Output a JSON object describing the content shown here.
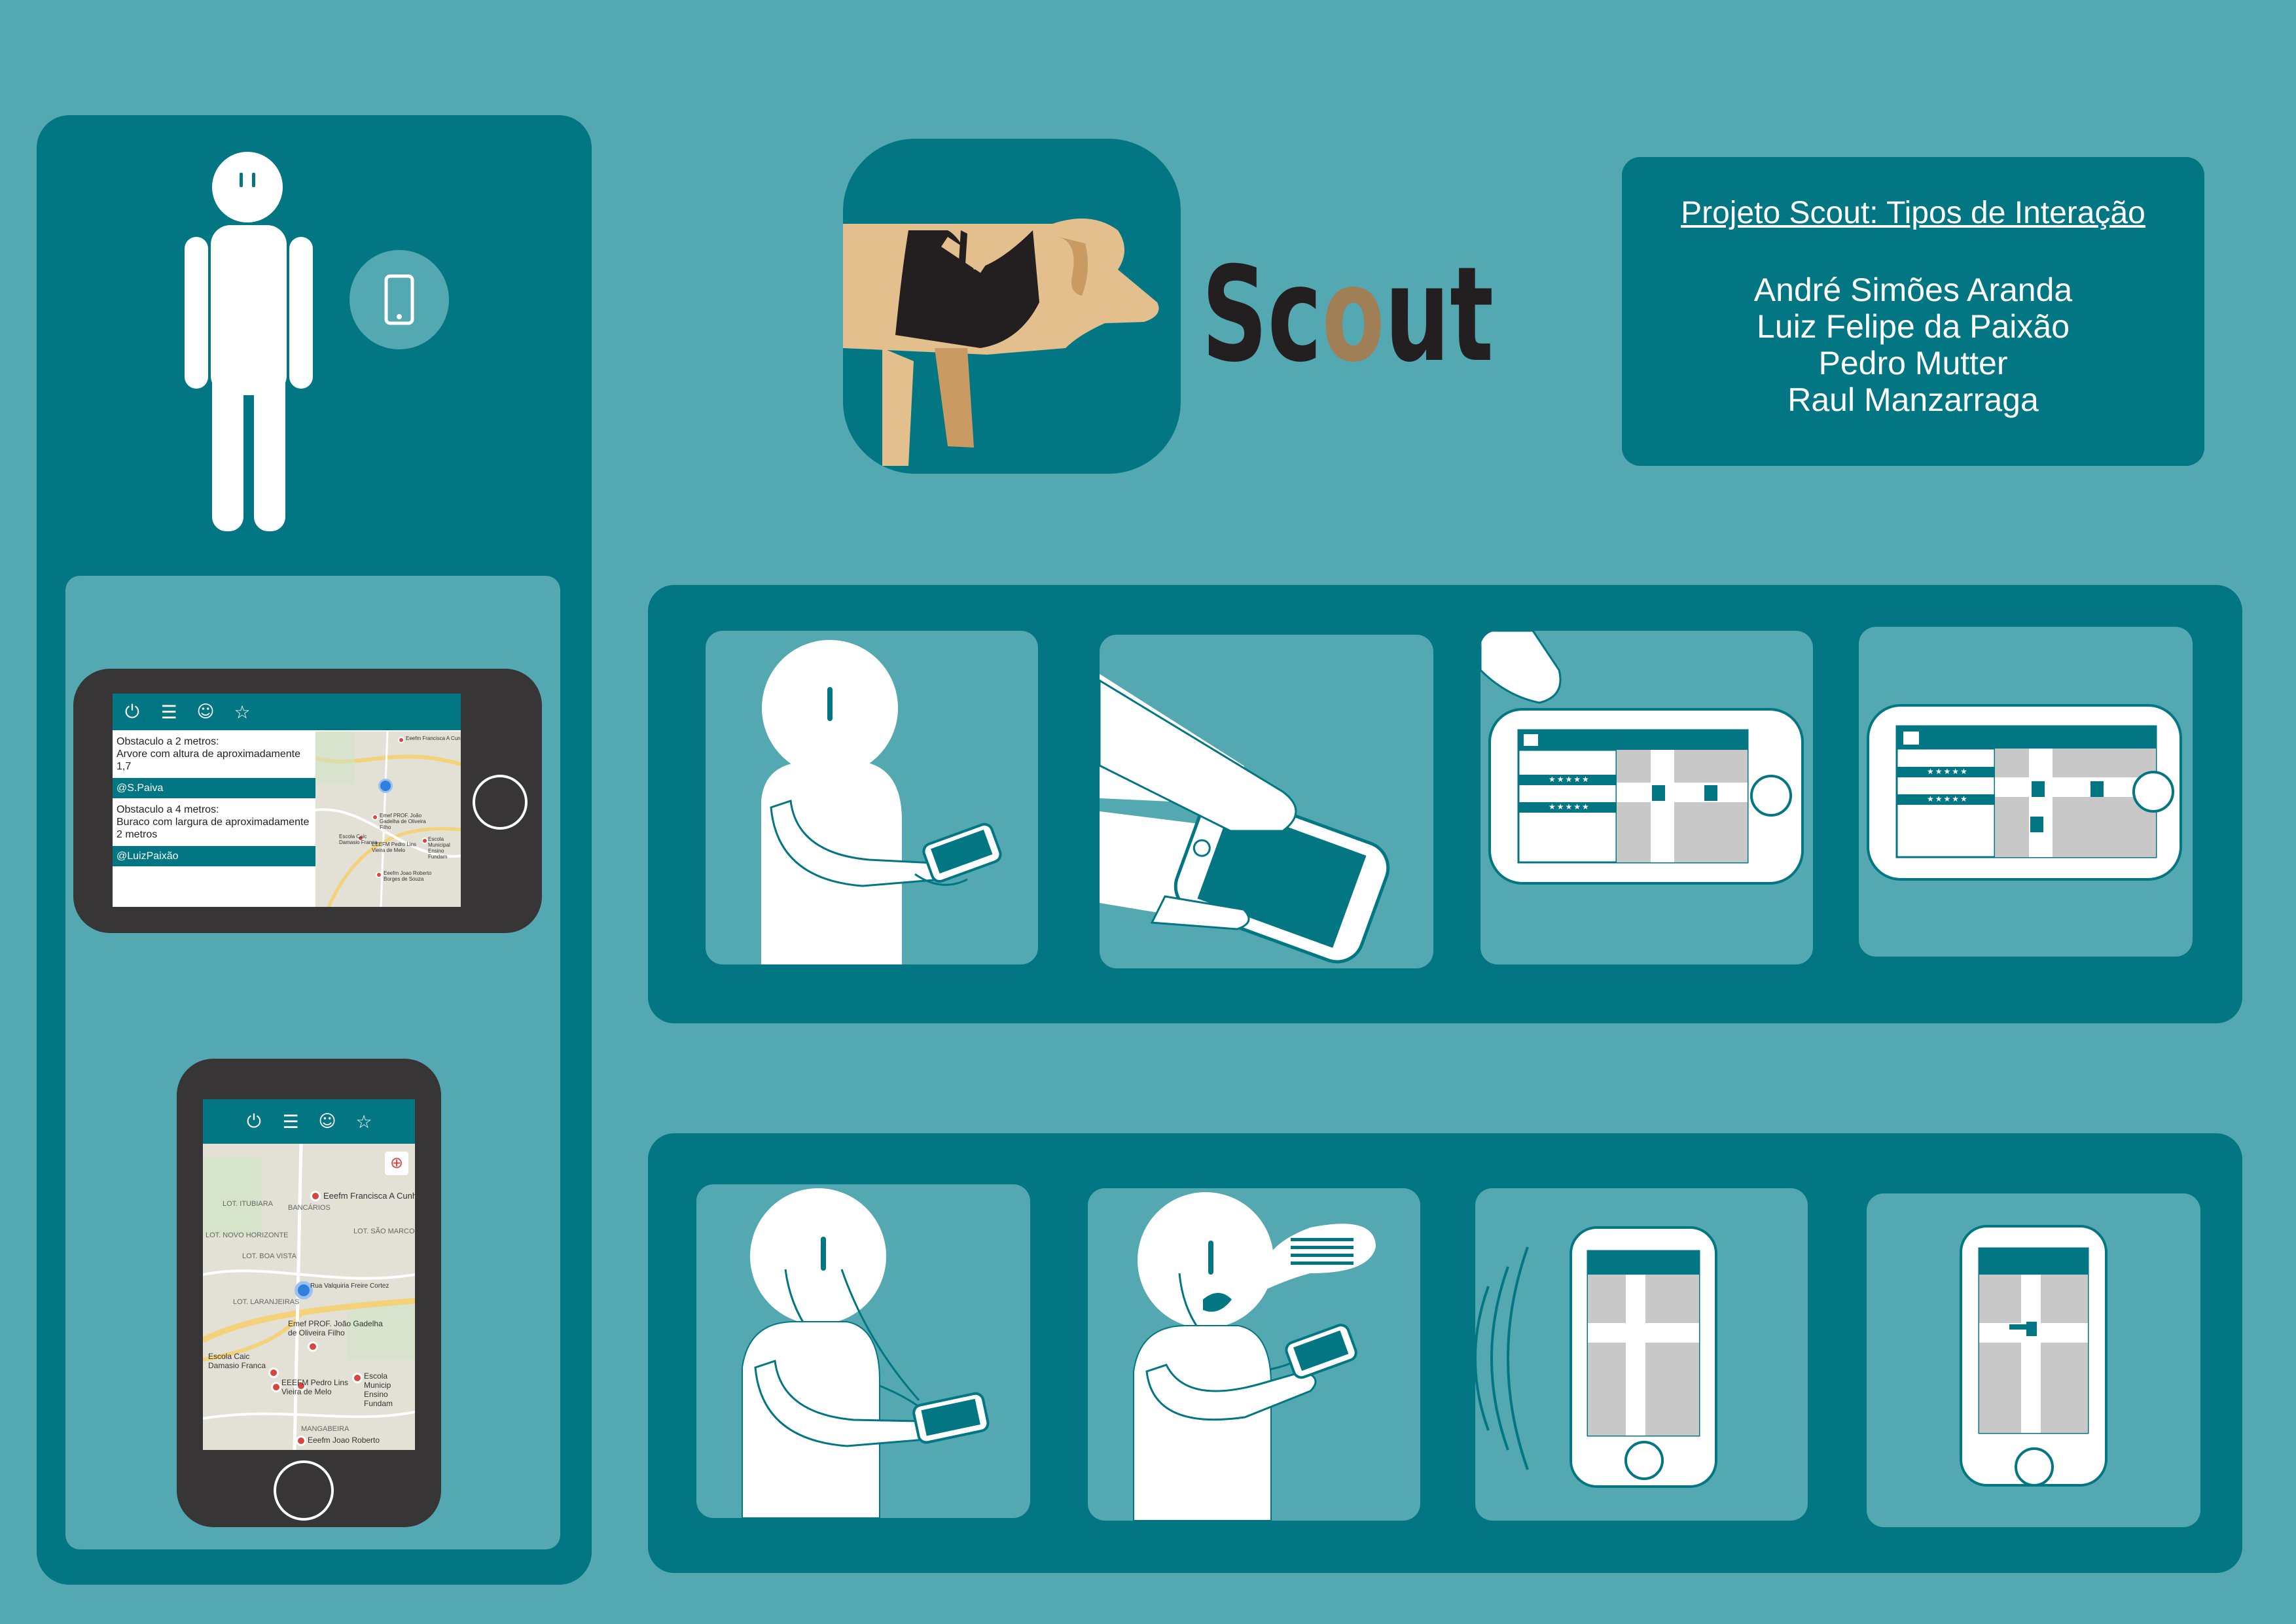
{
  "colors": {
    "background": "#54a8b2",
    "panel": "#027682",
    "white": "#ffffff",
    "phone_body": "#373536",
    "dog_tan": "#e3bf8d",
    "logo_o": "#a07f56",
    "logo_text": "#231f20"
  },
  "logo": {
    "wordmark": "Scout",
    "icon": "guide-dog-icon"
  },
  "credits": {
    "title": "Projeto Scout: Tipos de Interação",
    "names": [
      "André Simões Aranda",
      "Luiz Felipe da Paixão",
      "Pedro Mutter",
      "Raul Manzarraga"
    ]
  },
  "app": {
    "nav_icons": [
      "power-icon",
      "list-icon",
      "user-icon",
      "star-icon"
    ],
    "nav_glyphs": [
      "⏻",
      "☰",
      "👤",
      "☆"
    ],
    "posts": [
      {
        "text_line1": "Obstaculo a 2 metros:",
        "text_line2": "Arvore com altura de aproximadamente 1,7",
        "author": "@S.Paiva"
      },
      {
        "text_line1": "Obstaculo a 4 metros:",
        "text_line2": "Buraco com largura de aproximadamente 2 metros",
        "author": "@LuizPaixão"
      }
    ],
    "map_labels_small": [
      "Eeefm Francisca A Cunha",
      "Emef PROF. João Gadelha de Oliveira Filho",
      "Escola Caic Damasio Franca",
      "EEEFM Pedro Lins Vieira de Melo",
      "Escola Municipal Ensino Fundam",
      "Eeefm Joao Roberto Borges de Souza"
    ],
    "map_labels_large": {
      "poi_1": "Eeefm Francisca A Cunha",
      "poi_2": "Emef PROF. João Gadelha de Oliveira Filho",
      "poi_3": "Escola Caic Damasio Franca",
      "poi_4": "EEEFM Pedro Lins Vieira de Melo",
      "poi_5": "Escola Municip Ensino Fundam",
      "poi_6": "Eeefm Joao Roberto",
      "area_1": "LOT. ITUBIARA",
      "area_2": "BANCÁRIOS",
      "area_3": "LOT. NOVO HORIZONTE",
      "area_4": "LOT. BOA VISTA",
      "area_5": "LOT. LARANJEIRAS",
      "area_6": "MANGABEIRA",
      "area_7": "LOT. SÃO MARCOS",
      "street_1": "Rua Valquiria Freire Cortez"
    }
  },
  "storyboard": {
    "row1": [
      "person-holding-phone",
      "finger-touching-screen",
      "finger-on-landscape-app",
      "landscape-app-map"
    ],
    "row2": [
      "person-with-earphones",
      "person-speaking-to-phone",
      "phone-vibrating",
      "portrait-app-map"
    ],
    "rating_stars": "★★★★★"
  }
}
